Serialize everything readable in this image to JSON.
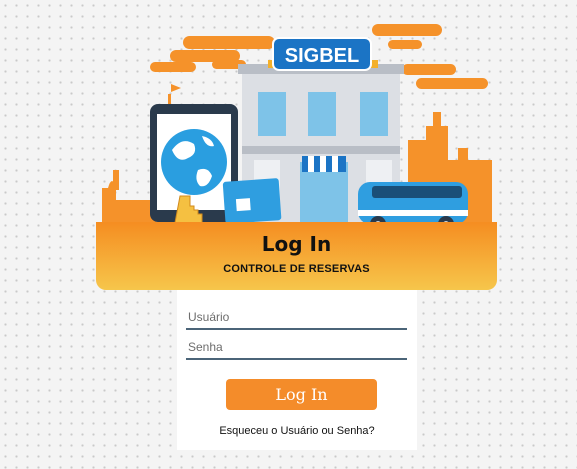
{
  "app": {
    "logo_text": "SIGBEL"
  },
  "banner": {
    "title": "Log In",
    "subtitle": "CONTROLE DE RESERVAS"
  },
  "login": {
    "username_placeholder": "Usuário",
    "password_placeholder": "Senha",
    "username_value": "",
    "password_value": "",
    "button_label": "Log In",
    "forgot_link": "Esqueceu o Usuário ou Senha?"
  },
  "colors": {
    "accent_orange": "#f48c2a",
    "banner_gradient_top": "#f58d21",
    "banner_gradient_bottom": "#f6c64b",
    "logo_blue": "#1b74c5",
    "field_underline": "#4b6478"
  }
}
